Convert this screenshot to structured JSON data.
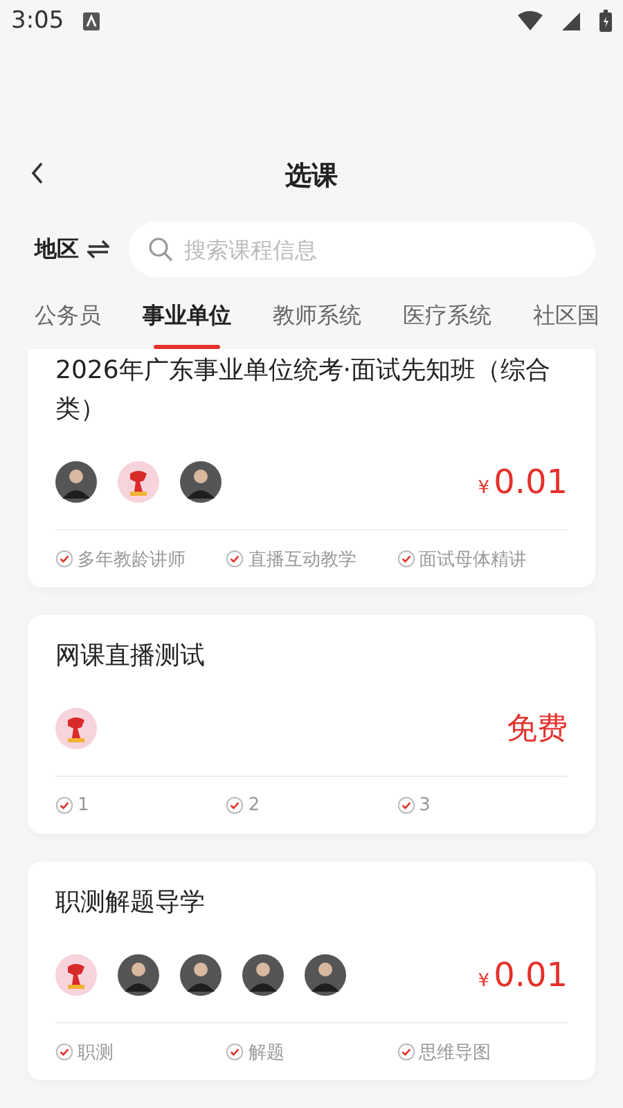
{
  "status_bar": {
    "time": "3:05"
  },
  "header": {
    "title": "选课"
  },
  "filter": {
    "region_label": "地区",
    "search": {
      "placeholder": "搜索课程信息"
    }
  },
  "tabs": [
    {
      "label": "公务员",
      "selected": false
    },
    {
      "label": "事业单位",
      "selected": true
    },
    {
      "label": "教师系统",
      "selected": false
    },
    {
      "label": "医疗系统",
      "selected": false
    },
    {
      "label": "社区国",
      "selected": false
    }
  ],
  "courses": [
    {
      "title": "2026年广东事业单位统考·面试先知班（综合类）",
      "teachers": [
        {
          "kind": "photo"
        },
        {
          "kind": "emblem"
        },
        {
          "kind": "photo"
        }
      ],
      "price": {
        "kind": "price",
        "currency": "¥",
        "amount": "0.01"
      },
      "features": [
        "多年教龄讲师",
        "直播互动教学",
        "面试母体精讲"
      ]
    },
    {
      "title": "网课直播测试",
      "teachers": [
        {
          "kind": "emblem"
        }
      ],
      "price": {
        "kind": "free",
        "text": "免费"
      },
      "features": [
        "1",
        "2",
        "3"
      ]
    },
    {
      "title": "职测解题导学",
      "teachers": [
        {
          "kind": "emblem"
        },
        {
          "kind": "photo"
        },
        {
          "kind": "photo"
        },
        {
          "kind": "photo"
        },
        {
          "kind": "photo"
        }
      ],
      "price": {
        "kind": "price",
        "currency": "¥",
        "amount": "0.01"
      },
      "features": [
        "职测",
        "解题",
        "思维导图"
      ]
    }
  ]
}
